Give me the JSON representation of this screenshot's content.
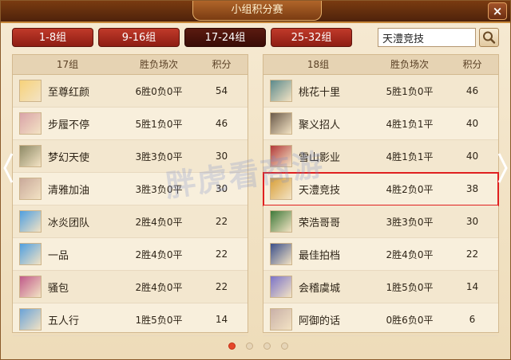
{
  "window": {
    "title": "小组积分赛",
    "close_label": "×"
  },
  "tabs": [
    {
      "label": "1-8组",
      "active": false
    },
    {
      "label": "9-16组",
      "active": false
    },
    {
      "label": "17-24组",
      "active": true
    },
    {
      "label": "25-32组",
      "active": false
    }
  ],
  "search": {
    "value": "天澧竞技",
    "button_icon": "search-icon"
  },
  "columns": {
    "record": "胜负场次",
    "points": "积分"
  },
  "left_group": {
    "title": "17组",
    "rows": [
      {
        "name": "至尊红颜",
        "record": "6胜0负0平",
        "points": "54",
        "avatar_color": "#f7d27a"
      },
      {
        "name": "步履不停",
        "record": "5胜1负0平",
        "points": "46",
        "avatar_color": "#d9a3a8"
      },
      {
        "name": "梦幻天使",
        "record": "3胜3负0平",
        "points": "30",
        "avatar_color": "#8e8a66"
      },
      {
        "name": "清雅加油",
        "record": "3胜3负0平",
        "points": "30",
        "avatar_color": "#c9a99a"
      },
      {
        "name": "冰炎团队",
        "record": "2胜4负0平",
        "points": "22",
        "avatar_color": "#4f9fe0"
      },
      {
        "name": "一品",
        "record": "2胜4负0平",
        "points": "22",
        "avatar_color": "#4f9fe0"
      },
      {
        "name": "骚包",
        "record": "2胜4负0平",
        "points": "22",
        "avatar_color": "#c05a8a"
      },
      {
        "name": "五人行",
        "record": "1胜5负0平",
        "points": "14",
        "avatar_color": "#6aa3d8"
      }
    ]
  },
  "right_group": {
    "title": "18组",
    "rows": [
      {
        "name": "桃花十里",
        "record": "5胜1负0平",
        "points": "46",
        "avatar_color": "#5b8a8c"
      },
      {
        "name": "聚义招人",
        "record": "4胜1负1平",
        "points": "40",
        "avatar_color": "#6b5a4a"
      },
      {
        "name": "雪山影业",
        "record": "4胜1负1平",
        "points": "40",
        "avatar_color": "#b23a3a"
      },
      {
        "name": "天澧竞技",
        "record": "4胜2负0平",
        "points": "38",
        "avatar_color": "#d8a03a",
        "highlighted": true
      },
      {
        "name": "荣浩哥哥",
        "record": "3胜3负0平",
        "points": "30",
        "avatar_color": "#3f7a3a"
      },
      {
        "name": "最佳拍档",
        "record": "2胜4负0平",
        "points": "22",
        "avatar_color": "#3b4f8a"
      },
      {
        "name": "会稽虞城",
        "record": "1胜5负0平",
        "points": "14",
        "avatar_color": "#7b73c8"
      },
      {
        "name": "阿御的话",
        "record": "0胜6负0平",
        "points": "6",
        "avatar_color": "#c9b0a8"
      }
    ]
  },
  "watermark": "胖虎看商游",
  "pagination": {
    "total": 4,
    "current": 1
  },
  "colors": {
    "accent": "#e5472a",
    "tab_red": "#b0301f",
    "highlight": "#e02020"
  }
}
